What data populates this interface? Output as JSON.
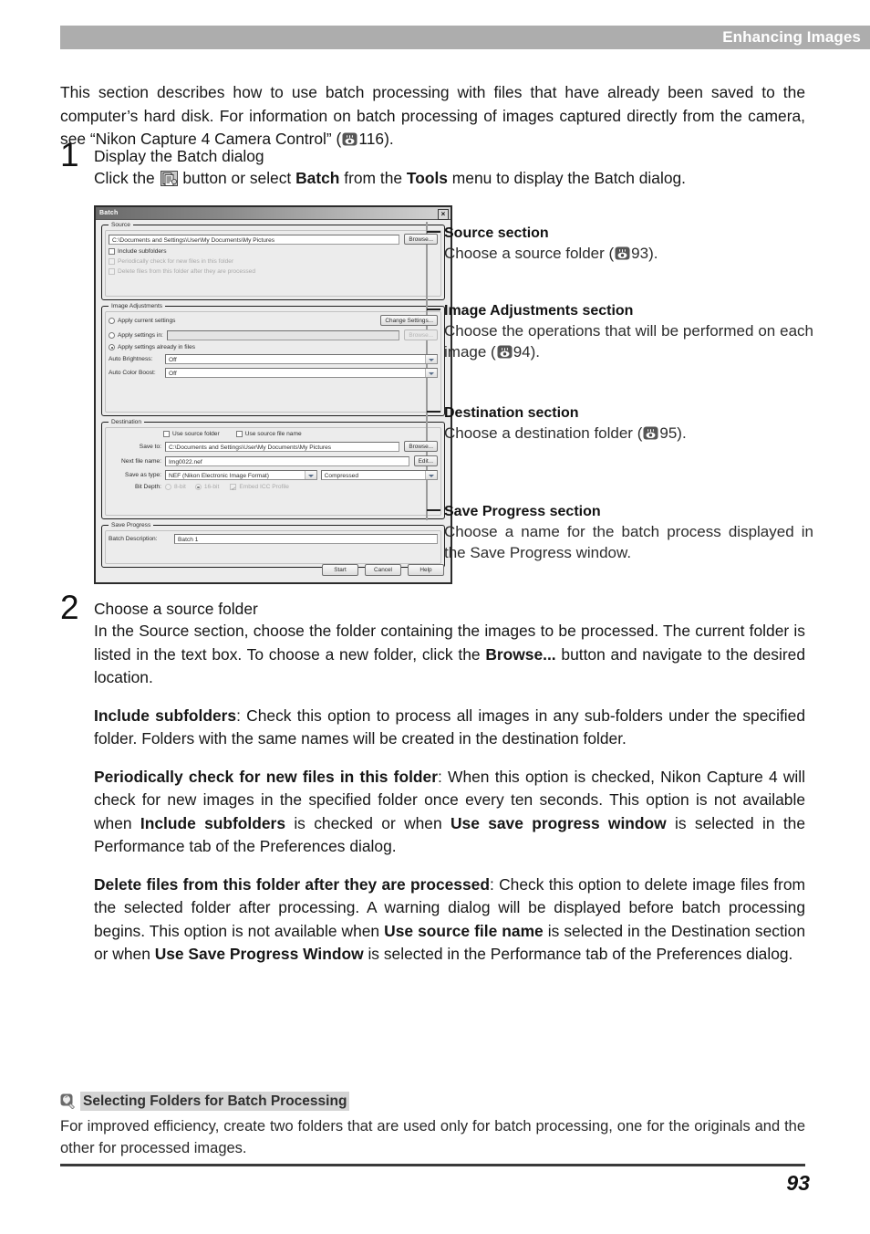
{
  "header": {
    "title": "Enhancing Images"
  },
  "intro": {
    "part1": "This section describes how to use batch processing with files that have already been saved to the computer’s hard disk. For information on batch processing of images captured directly from the camera, see “Nikon Capture 4 Camera Control” (",
    "ref_page": "116",
    "part2": ")."
  },
  "steps": [
    {
      "number": "1",
      "title": "Display the Batch dialog",
      "body_pre": "Click the ",
      "icon_name": "batch-button-icon",
      "body_mid1": " button or select ",
      "bold1": "Batch",
      "body_mid2": " from the ",
      "bold2": "Tools",
      "body_post": " menu to display the Batch dialog."
    },
    {
      "number": "2",
      "title": "Choose a source folder",
      "paragraphs": [
        {
          "runs": [
            {
              "text": "In the Source section, choose the folder containing the images to be processed. The current folder is listed in the text box. To choose a new folder, click the ",
              "bold": false
            },
            {
              "text": "Browse...",
              "bold": true
            },
            {
              "text": " button and navigate to the desired location.",
              "bold": false
            }
          ]
        },
        {
          "runs": [
            {
              "text": "Include subfolders",
              "bold": true
            },
            {
              "text": ": Check this option to process all images in any sub-folders under the specified folder. Folders with the same names will be created in the destination folder.",
              "bold": false
            }
          ]
        },
        {
          "runs": [
            {
              "text": "Periodically check for new files in this folder",
              "bold": true
            },
            {
              "text": ": When this option is checked, Nikon Capture 4 will check for new images in the specified folder once every ten seconds. This option is not available when ",
              "bold": false
            },
            {
              "text": "Include subfolders",
              "bold": true
            },
            {
              "text": " is checked or when ",
              "bold": false
            },
            {
              "text": "Use save progress window",
              "bold": true
            },
            {
              "text": " is selected in the Performance tab of the Preferences dialog.",
              "bold": false
            }
          ]
        },
        {
          "runs": [
            {
              "text": "Delete files from this folder after they are processed",
              "bold": true
            },
            {
              "text": ": Check this option to delete image files from the selected folder after processing. A warning dialog will be displayed before batch processing begins. This option is not available when ",
              "bold": false
            },
            {
              "text": "Use source file name",
              "bold": true
            },
            {
              "text": " is selected in the Destination section or when ",
              "bold": false
            },
            {
              "text": "Use Save Progress Window",
              "bold": true
            },
            {
              "text": " is selected in the Performance tab of the Preferences dialog.",
              "bold": false
            }
          ]
        }
      ]
    }
  ],
  "dialog": {
    "title": "Batch",
    "close_label": "×",
    "source": {
      "legend": "Source",
      "path_value": "C:\\Documents and Settings\\User\\My Documents\\My Pictures",
      "browse_label": "Browse...",
      "include_subfolders": "Include subfolders",
      "periodically_check": "Periodically check for new files in this folder",
      "delete_files": "Delete files from this folder after they are processed"
    },
    "image_adjustments": {
      "legend": "Image Adjustments",
      "apply_current": "Apply current settings",
      "change_settings_label": "Change Settings...",
      "apply_settings_in": "Apply settings in:",
      "apply_settings_value": "",
      "browse_label": "Browse...",
      "apply_already": "Apply settings already in files",
      "auto_brightness_label": "Auto Brightness:",
      "auto_brightness_value": "Off",
      "auto_color_boost_label": "Auto Color Boost:",
      "auto_color_boost_value": "Off"
    },
    "destination": {
      "legend": "Destination",
      "use_source_folder": "Use source folder",
      "use_source_file_name": "Use source file name",
      "save_to_label": "Save to:",
      "save_to_value": "C:\\Documents and Settings\\User\\My Documents\\My Pictures",
      "browse_label": "Browse...",
      "next_file_name_label": "Next file name:",
      "next_file_name_value": "Img0022.nef",
      "edit_label": "Edit...",
      "save_as_type_label": "Save as type:",
      "save_as_type_value": "NEF (Nikon Electronic Image Format)",
      "compression_value": "Compressed",
      "bit_depth_label": "Bit Depth:",
      "bit_depth_8": "8-bit",
      "bit_depth_16": "16-bit",
      "embed_icc": "Embed ICC Profile"
    },
    "save_progress": {
      "legend": "Save Progress",
      "batch_description_label": "Batch Description:",
      "batch_description_value": "Batch 1"
    },
    "buttons": {
      "start": "Start",
      "cancel": "Cancel",
      "help": "Help"
    }
  },
  "callouts": [
    {
      "title": "Source section",
      "text_pre": "Choose a source folder (",
      "ref_page": "93",
      "text_post": ")."
    },
    {
      "title": "Image Adjustments section",
      "text_pre": "Choose the operations that will be performed on each image (",
      "ref_page": "94",
      "text_post": ")."
    },
    {
      "title": "Destination section",
      "text_pre": "Choose a destination folder (",
      "ref_page": "95",
      "text_post": ")."
    },
    {
      "title": "Save Progress section",
      "text_pre": "Choose a name for the batch process displayed in the Save Progress window.",
      "ref_page": "",
      "text_post": ""
    }
  ],
  "note": {
    "icon_name": "tip-bulb-icon",
    "title": "Selecting Folders for Batch Processing",
    "body": "For improved efficiency, create two folders that are used only for batch processing, one for the originals and the other for processed images."
  },
  "footer": {
    "page_number": "93"
  },
  "colors": {
    "header_bar": "#adadad",
    "note_title_bg": "#d4d4d4",
    "dialog_bg": "#ececec"
  }
}
